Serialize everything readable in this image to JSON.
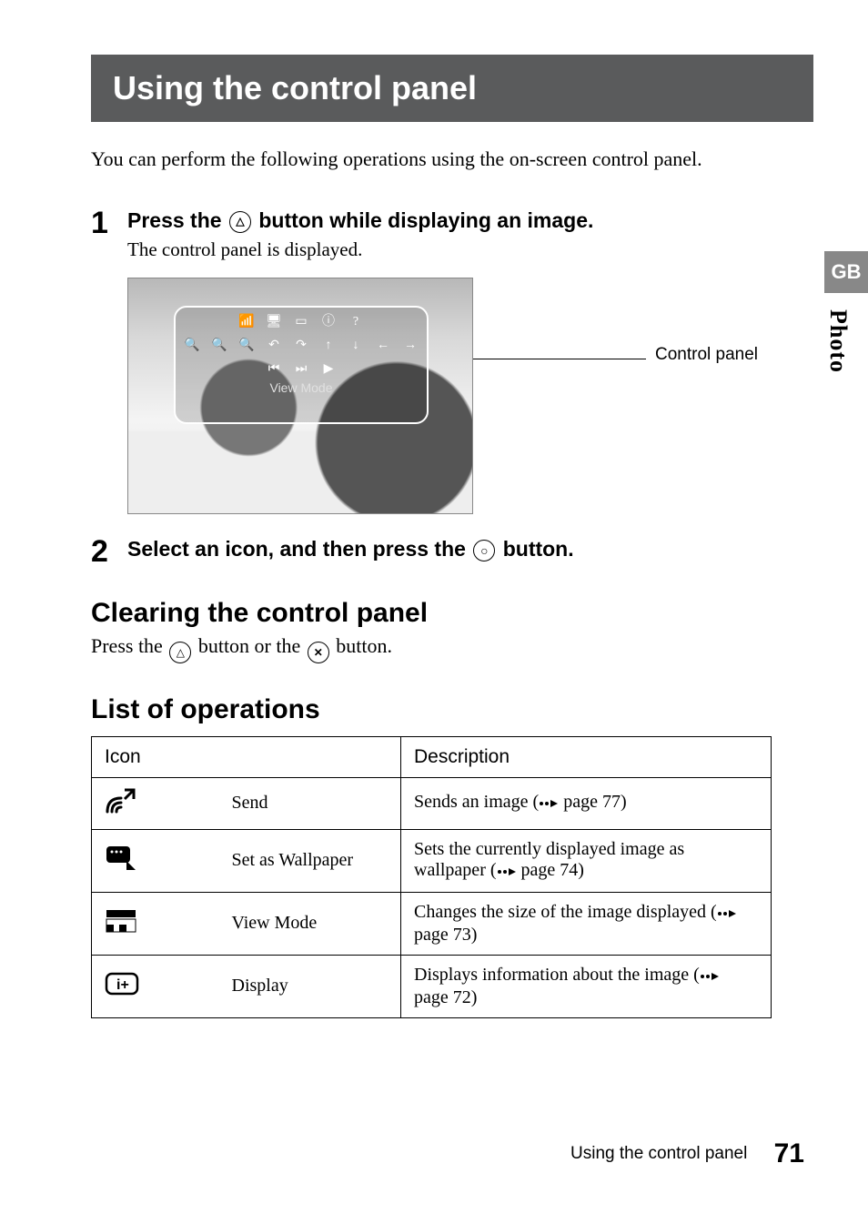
{
  "title": "Using the control panel",
  "intro": "You can perform the following operations using the on-screen control panel.",
  "steps": [
    {
      "num": "1",
      "title_before": "Press the ",
      "title_after": " button while displaying an image.",
      "sub": "The control panel is displayed."
    },
    {
      "num": "2",
      "title_before": "Select an icon, and then press the ",
      "title_after": " button."
    }
  ],
  "callout": "Control panel",
  "screenshot_label": "View Mode",
  "tabs": {
    "gb": "GB",
    "photo": "Photo"
  },
  "sections": {
    "clearing": {
      "heading": "Clearing the control panel",
      "text_before": "Press the ",
      "text_mid": " button or the ",
      "text_after": " button."
    },
    "list": {
      "heading": "List of operations",
      "col_icon": "Icon",
      "col_desc": "Description"
    }
  },
  "rows": [
    {
      "name": "Send",
      "desc_before": "Sends an image (",
      "desc_after": " page 77)"
    },
    {
      "name": "Set as Wallpaper",
      "desc_before": "Sets the currently displayed image as wallpaper (",
      "desc_after": " page 74)"
    },
    {
      "name": "View Mode",
      "desc_before": "Changes the size of the image displayed (",
      "desc_after": " page 73)"
    },
    {
      "name": "Display",
      "desc_before": "Displays information about the image (",
      "desc_after": " page 72)"
    }
  ],
  "footer": {
    "label": "Using the control panel",
    "page": "71"
  }
}
